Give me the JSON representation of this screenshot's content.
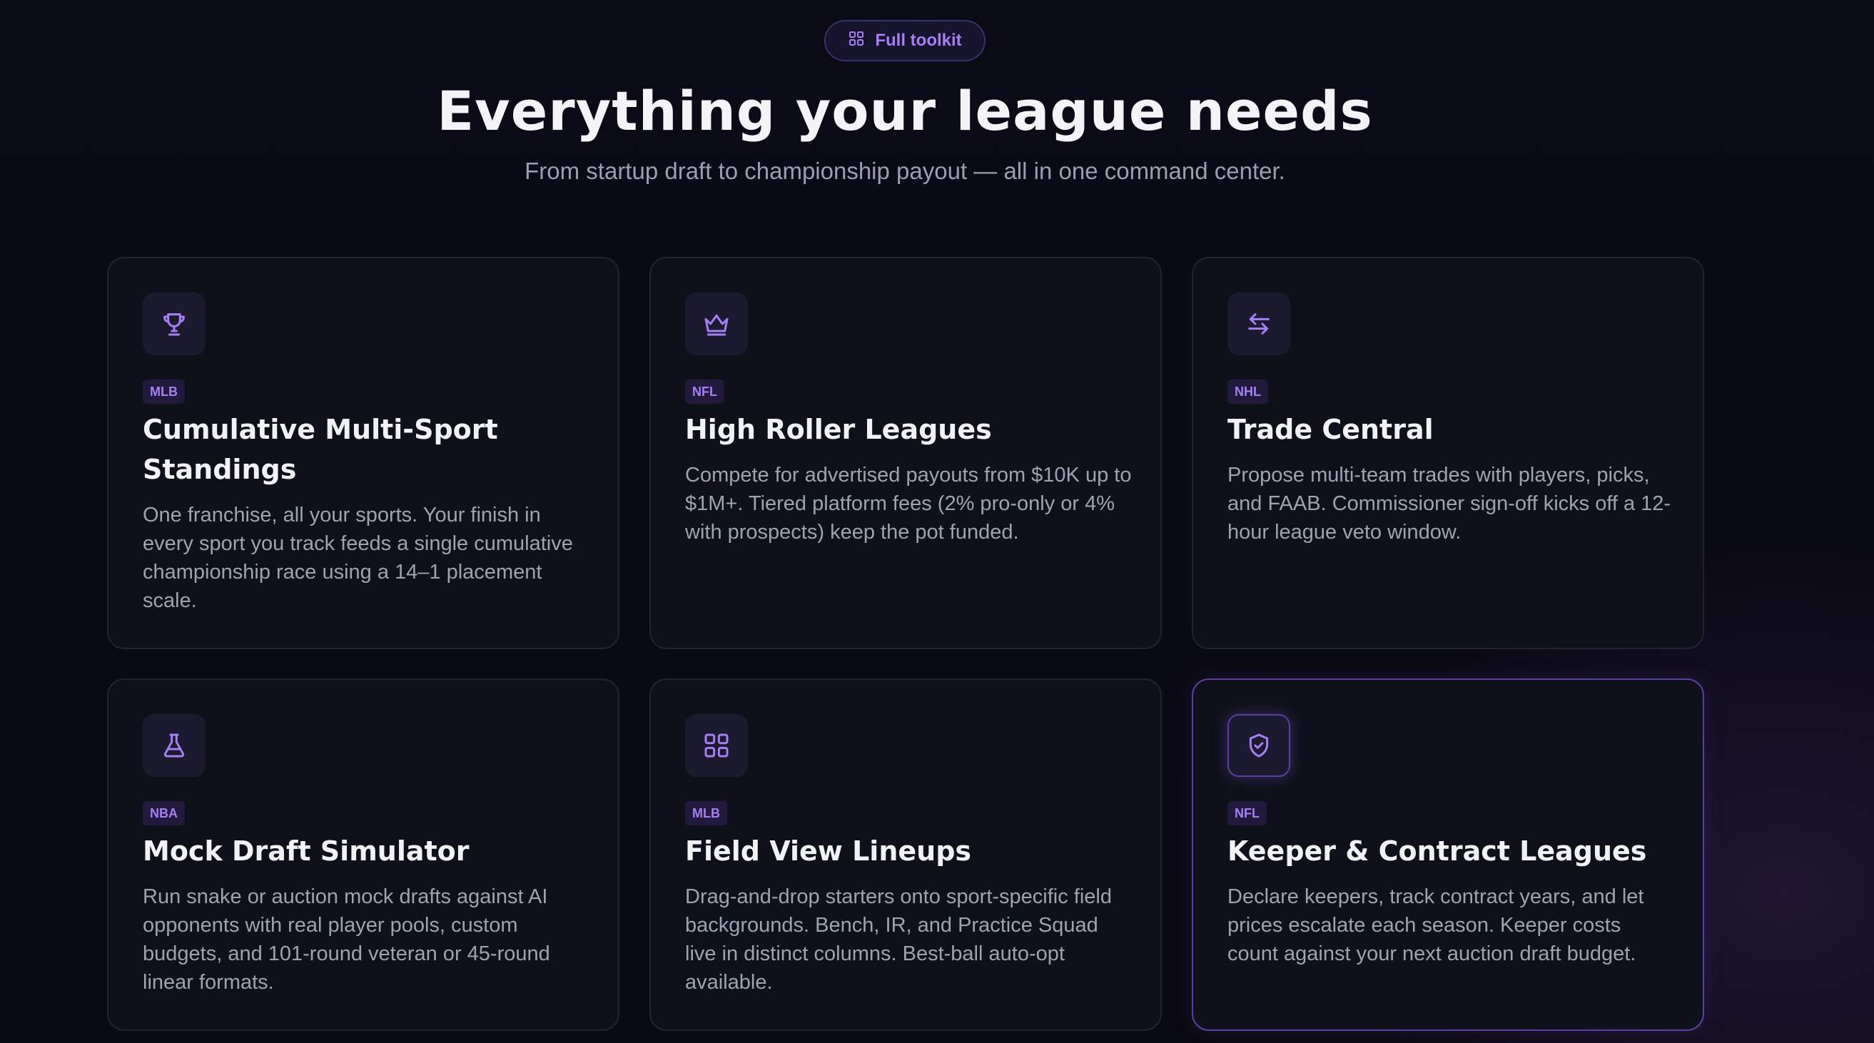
{
  "header": {
    "pill_label": "Full toolkit",
    "pill_icon": "grid-icon",
    "title": "Everything your league needs",
    "subtitle": "From startup draft to championship payout — all in one command center."
  },
  "colors": {
    "accent": "#a67ff2",
    "card_bg": "#0e111a",
    "card_border": "#1f2430",
    "highlight_border": "#5a3f9e"
  },
  "cards": [
    {
      "icon": "trophy-icon",
      "badge": "MLB",
      "title": "Cumulative Multi-Sport Standings",
      "description": "One franchise, all your sports. Your finish in every sport you track feeds a single cumulative championship race using a 14–1 placement scale."
    },
    {
      "icon": "crown-icon",
      "badge": "NFL",
      "title": "High Roller Leagues",
      "description": "Compete for advertised payouts from $10K up to $1M+. Tiered platform fees (2% pro-only or 4% with prospects) keep the pot funded."
    },
    {
      "icon": "swap-arrows-icon",
      "badge": "NHL",
      "title": "Trade Central",
      "description": "Propose multi-team trades with players, picks, and FAAB. Commissioner sign-off kicks off a 12-hour league veto window."
    },
    {
      "icon": "flask-icon",
      "badge": "NBA",
      "title": "Mock Draft Simulator",
      "description": "Run snake or auction mock drafts against AI opponents with real player pools, custom budgets, and 101-round veteran or 45-round linear formats."
    },
    {
      "icon": "grid-icon",
      "badge": "MLB",
      "title": "Field View Lineups",
      "description": "Drag-and-drop starters onto sport-specific field backgrounds. Bench, IR, and Practice Squad live in distinct columns. Best-ball auto-opt available."
    },
    {
      "icon": "shield-check-icon",
      "badge": "NFL",
      "title": "Keeper & Contract Leagues",
      "description": "Declare keepers, track contract years, and let prices escalate each season. Keeper costs count against your next auction draft budget."
    }
  ]
}
